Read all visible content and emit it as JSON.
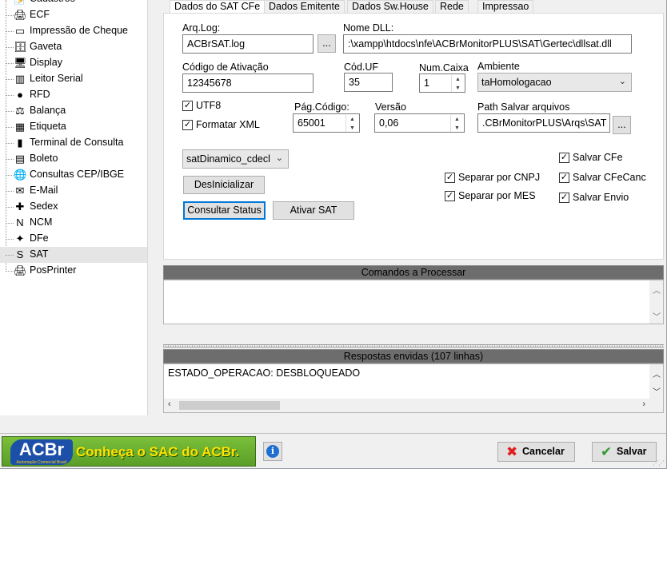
{
  "tree": {
    "items": [
      {
        "label": "Cadastros",
        "icon": "📝",
        "icon_name": "cadastros-icon"
      },
      {
        "label": "ECF",
        "icon": "🖨",
        "icon_name": "printer-icon"
      },
      {
        "label": "Impressão de Cheque",
        "icon": "▭",
        "icon_name": "cheque-icon"
      },
      {
        "label": "Gaveta",
        "icon": "🗄",
        "icon_name": "cash-drawer-icon"
      },
      {
        "label": "Display",
        "icon": "🖥",
        "icon_name": "display-icon"
      },
      {
        "label": "Leitor Serial",
        "icon": "▥",
        "icon_name": "barcode-reader-icon"
      },
      {
        "label": "RFD",
        "icon": "●",
        "icon_name": "rfd-icon"
      },
      {
        "label": "Balança",
        "icon": "⚖",
        "icon_name": "scale-icon"
      },
      {
        "label": "Etiqueta",
        "icon": "▦",
        "icon_name": "label-printer-icon"
      },
      {
        "label": "Terminal de Consulta",
        "icon": "▮",
        "icon_name": "terminal-icon"
      },
      {
        "label": "Boleto",
        "icon": "▤",
        "icon_name": "boleto-icon"
      },
      {
        "label": "Consultas CEP/IBGE",
        "icon": "🌐",
        "icon_name": "globe-icon"
      },
      {
        "label": "E-Mail",
        "icon": "✉",
        "icon_name": "email-icon"
      },
      {
        "label": "Sedex",
        "icon": "✚",
        "icon_name": "sedex-icon"
      },
      {
        "label": "NCM",
        "icon": "N",
        "icon_name": "ncm-icon"
      },
      {
        "label": "DFe",
        "icon": "✦",
        "icon_name": "dfe-icon"
      },
      {
        "label": "SAT",
        "icon": "S",
        "icon_name": "sat-icon",
        "selected": true
      },
      {
        "label": "PosPrinter",
        "icon": "🖨",
        "icon_name": "posprinter-icon"
      }
    ]
  },
  "tabs": [
    {
      "label": "Dados do SAT CFe",
      "active": true
    },
    {
      "label": "Dados Emitente"
    },
    {
      "label": "Dados Sw.House"
    },
    {
      "label": "Rede"
    },
    {
      "label": "Impressao"
    }
  ],
  "form": {
    "arq_log_label": "Arq.Log:",
    "arq_log_value": "ACBrSAT.log",
    "browse_label": "...",
    "nome_dll_label": "Nome DLL:",
    "nome_dll_value": ":\\xampp\\htdocs\\nfe\\ACBrMonitorPLUS\\SAT\\Gertec\\dllsat.dll",
    "codigo_ativacao_label": "Código de Ativação",
    "codigo_ativacao_value": "12345678",
    "cod_uf_label": "Cód.UF",
    "cod_uf_value": "35",
    "num_caixa_label": "Num.Caixa",
    "num_caixa_value": "1",
    "ambiente_label": "Ambiente",
    "ambiente_value": "taHomologacao",
    "utf8_label": "UTF8",
    "formatar_xml_label": "Formatar XML",
    "pag_codigo_label": "Pág.Código:",
    "pag_codigo_value": "65001",
    "versao_label": "Versão",
    "versao_value": "0,06",
    "path_salvar_label": "Path Salvar arquivos",
    "path_salvar_value": ".CBrMonitorPLUS\\Arqs\\SAT",
    "modelo_value": "satDinamico_cdecl",
    "desinicializar_label": "DesInicializar",
    "consultar_status_label": "Consultar Status",
    "ativar_sat_label": "Ativar SAT",
    "separar_cnpj_label": "Separar por CNPJ",
    "separar_mes_label": "Separar por MES",
    "salvar_cfe_label": "Salvar CFe",
    "salvar_cfecanc_label": "Salvar CFeCanc",
    "salvar_envio_label": "Salvar Envio",
    "check_mark": "✓"
  },
  "comandos": {
    "title": "Comandos a Processar",
    "text": ""
  },
  "respostas": {
    "title": "Respostas envidas (107 linhas)",
    "text": "ESTADO_OPERACAO: DESBLOQUEADO"
  },
  "bottom": {
    "banner_logo": "ACBr",
    "banner_logo_sub": "Automação Comercial Brasil",
    "banner_text": "Conheça o SAC do ACBr.",
    "info_label": "i",
    "cancelar_label": "Cancelar",
    "salvar_label": "Salvar",
    "cancel_icon": "✖",
    "save_icon": "✔"
  },
  "colors": {
    "selection": "#e5e5e5",
    "panel_header": "#6d6d6d",
    "banner_green": "#6aae30",
    "banner_text": "#ffe400",
    "focus_border": "#0078d7",
    "cancel_red": "#e02020",
    "save_green": "#2e9b2e"
  }
}
